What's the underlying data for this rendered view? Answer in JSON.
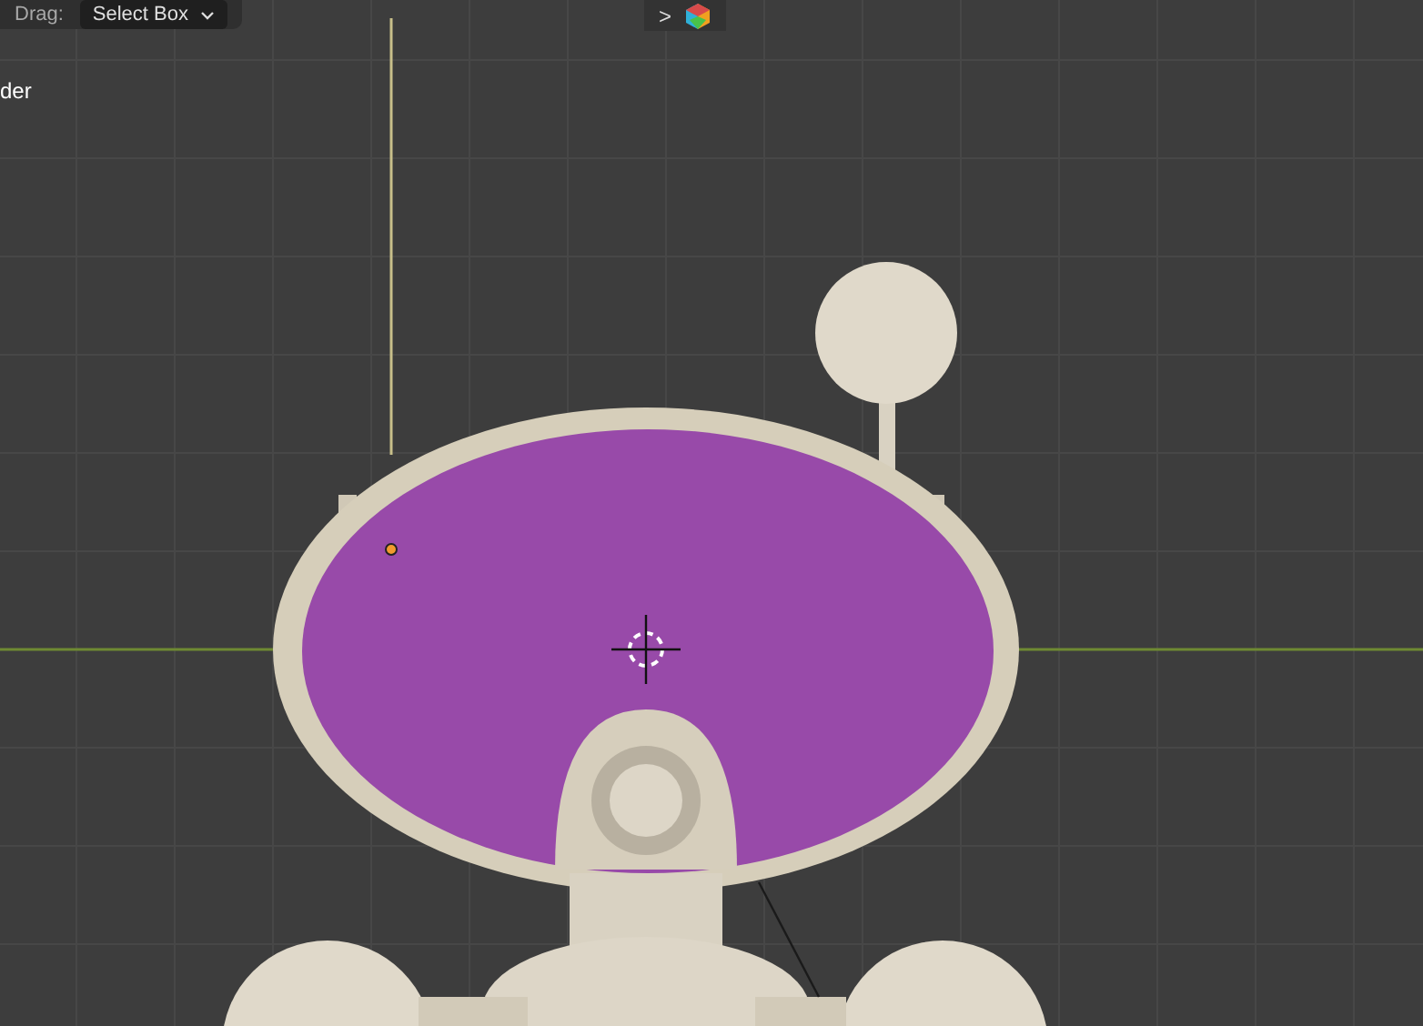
{
  "header": {
    "drag_label": "Drag:",
    "tool_dropdown": "Select Box"
  },
  "overlay_text": "der",
  "navigation": {
    "toggle": ">"
  }
}
